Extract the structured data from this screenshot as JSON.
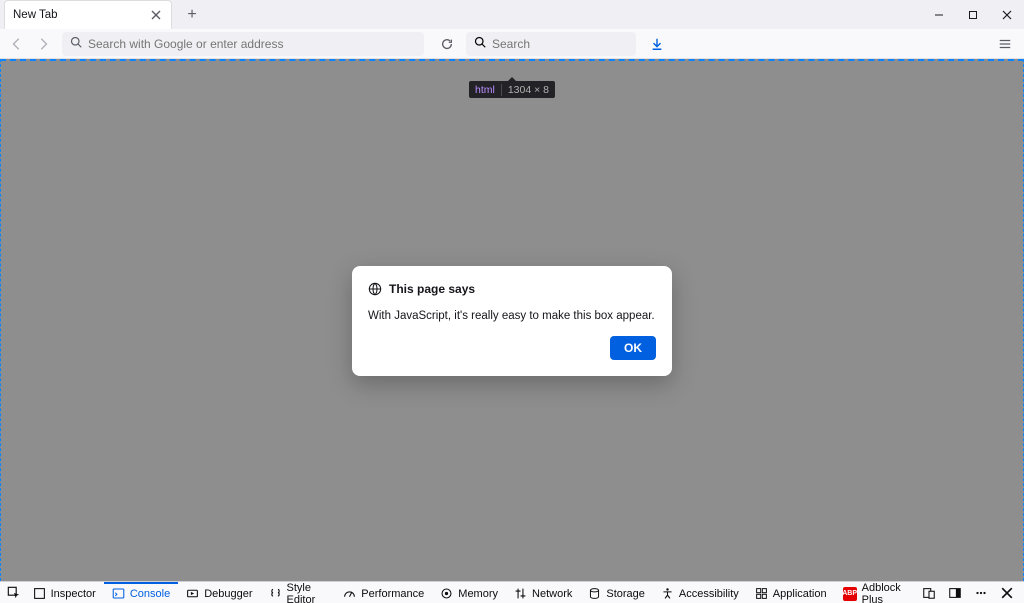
{
  "tab": {
    "title": "New Tab"
  },
  "urlbar": {
    "placeholder": "Search with Google or enter address"
  },
  "searchbar": {
    "placeholder": "Search"
  },
  "inspector_tooltip": {
    "tag": "html",
    "dimensions": "1304 × 8"
  },
  "dialog": {
    "title": "This page says",
    "message": "With JavaScript, it's really easy to make this box appear.",
    "ok_label": "OK"
  },
  "devtools": {
    "tabs": [
      "Inspector",
      "Console",
      "Debugger",
      "Style Editor",
      "Performance",
      "Memory",
      "Network",
      "Storage",
      "Accessibility",
      "Application",
      "Adblock Plus"
    ],
    "active": "Console"
  }
}
